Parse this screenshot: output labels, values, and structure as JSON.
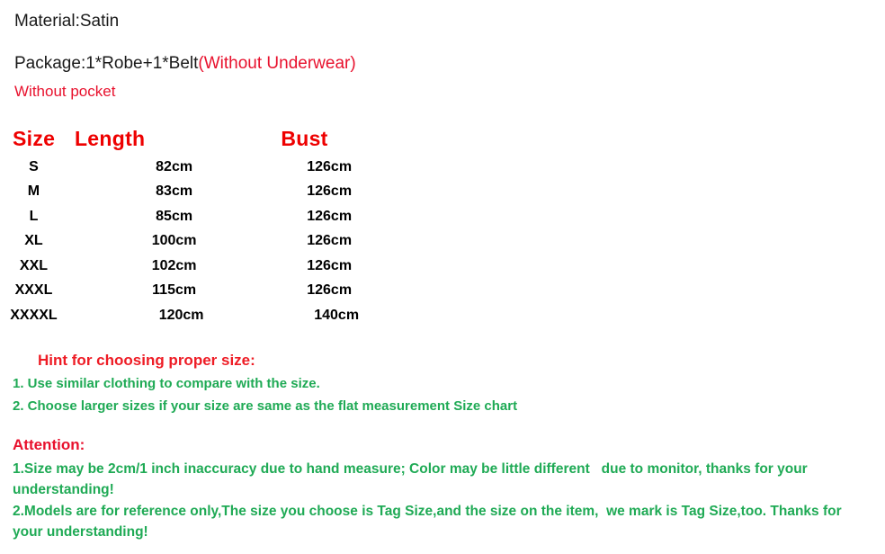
{
  "product_info": {
    "material_line": "Material:Satin",
    "package_label": "Package:1*Robe+1*Belt",
    "package_note": "(Without Underwear)",
    "pocket_note": "Without pocket"
  },
  "size_chart": {
    "headers": [
      "Size",
      "Length",
      "Bust"
    ],
    "rows": [
      {
        "size": "S",
        "length": "82cm",
        "bust": "126cm"
      },
      {
        "size": "M",
        "length": "83cm",
        "bust": "126cm"
      },
      {
        "size": "L",
        "length": "85cm",
        "bust": "126cm"
      },
      {
        "size": "XL",
        "length": "100cm",
        "bust": "126cm"
      },
      {
        "size": "XXL",
        "length": "102cm",
        "bust": "126cm"
      },
      {
        "size": "XXXL",
        "length": "115cm",
        "bust": "126cm"
      },
      {
        "size": "XXXXL",
        "length": "120cm",
        "bust": "140cm"
      }
    ]
  },
  "hint": {
    "title": "Hint for choosing proper size:",
    "items": [
      "1. Use similar clothing to compare with the size.",
      "2. Choose larger sizes if your size are same as the flat measurement Size chart"
    ]
  },
  "attention": {
    "title": "Attention:",
    "items": [
      "1.Size may be 2cm/1 inch inaccuracy due to hand measure; Color may be little different   due to monitor, thanks for your understanding!",
      "2.Models are for reference only,The size you choose is Tag Size,and the size on the item,  we mark is Tag Size,too. Thanks for your understanding!"
    ]
  },
  "colors": {
    "red": "#ee0000",
    "red_note": "#e8112d",
    "green": "#1faa55",
    "black": "#000000",
    "background": "#ffffff"
  }
}
